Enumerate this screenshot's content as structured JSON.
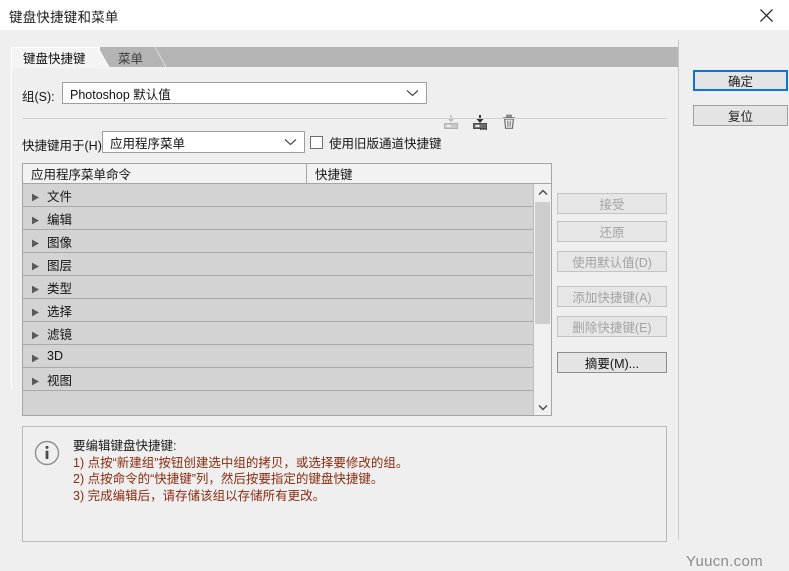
{
  "window": {
    "title": "键盘快捷键和菜单",
    "close_icon": "close-icon"
  },
  "tabs": [
    {
      "label": "键盘快捷键",
      "active": true
    },
    {
      "label": "菜单",
      "active": false
    }
  ],
  "group_row": {
    "label": "组(S):",
    "value": "Photoshop 默认值",
    "icons": [
      {
        "name": "save-icon",
        "enabled": false
      },
      {
        "name": "save-as-icon",
        "enabled": true
      },
      {
        "name": "delete-icon",
        "enabled": true
      }
    ]
  },
  "usefor_row": {
    "label": "快捷键用于(H):",
    "value": "应用程序菜单",
    "checkbox_label": "使用旧版通道快捷键",
    "checkbox_checked": false
  },
  "list": {
    "columns": [
      "应用程序菜单命令",
      "快捷键"
    ],
    "rows": [
      {
        "label": "文件",
        "shortcut": ""
      },
      {
        "label": "编辑",
        "shortcut": ""
      },
      {
        "label": "图像",
        "shortcut": ""
      },
      {
        "label": "图层",
        "shortcut": ""
      },
      {
        "label": "类型",
        "shortcut": ""
      },
      {
        "label": "选择",
        "shortcut": ""
      },
      {
        "label": "滤镜",
        "shortcut": ""
      },
      {
        "label": "3D",
        "shortcut": ""
      },
      {
        "label": "视图",
        "shortcut": ""
      }
    ]
  },
  "side_buttons": [
    {
      "label": "接受",
      "enabled": false
    },
    {
      "label": "还原",
      "enabled": false
    },
    {
      "label": "使用默认值(D)",
      "enabled": false
    },
    {
      "label": "添加快捷键(A)",
      "enabled": false
    },
    {
      "label": "删除快捷键(E)",
      "enabled": false
    },
    {
      "label": "摘要(M)...",
      "enabled": true
    }
  ],
  "action_buttons": {
    "ok": "确定",
    "reset": "复位"
  },
  "info": {
    "icon": "info-icon",
    "heading": "要编辑键盘快捷键:",
    "lines": [
      "1) 点按“新建组”按钮创建选中组的拷贝，或选择要修改的组。",
      "2) 点按命令的“快捷键”列，然后按要指定的键盘快捷键。",
      "3) 完成编辑后，请存储该组以存储所有更改。"
    ]
  },
  "watermark": "Yuucn.com",
  "colors": {
    "accent": "#0a74dc",
    "dialog_bg": "#efefef",
    "titlebar_bg": "#ffffff",
    "list_row_bg": "#d3d3d3",
    "tabstrip_bg": "#b4b4b4"
  }
}
